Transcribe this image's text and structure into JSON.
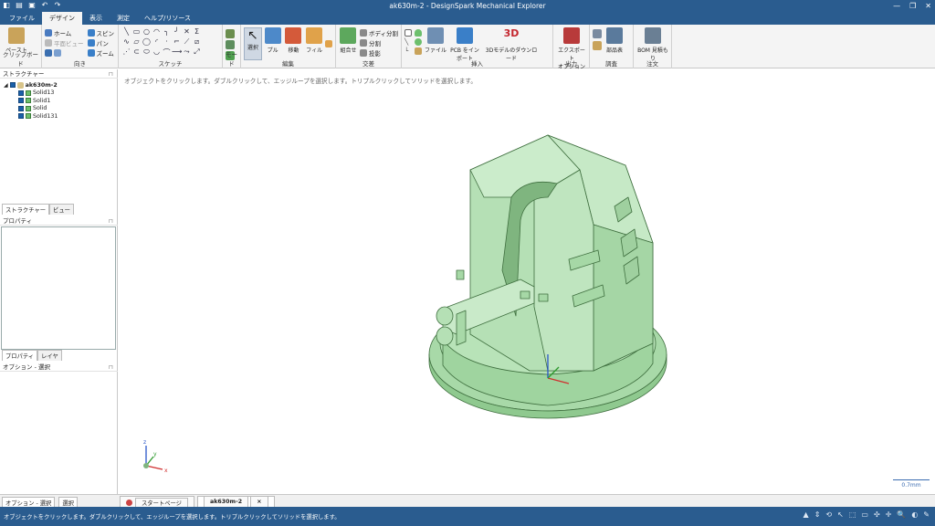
{
  "window": {
    "title": "ak630m-2 - DesignSpark Mechanical Explorer"
  },
  "menu": {
    "tabs": [
      "ファイル",
      "デザイン",
      "表示",
      "測定",
      "ヘルプ/リソース"
    ],
    "active_index": 1
  },
  "ribbon": {
    "clipboard": {
      "paste": "ペースト",
      "label": "クリップボード"
    },
    "orient": {
      "home": "ホーム",
      "spin": "スピン",
      "plan_view": "平面ビュー",
      "pan": "パン",
      "zoom": "ズーム",
      "label": "向き"
    },
    "sketch": {
      "label": "スケッチ"
    },
    "mode": {
      "label": "モード"
    },
    "edit": {
      "select": "選択",
      "pull": "プル",
      "move": "移動",
      "fill": "フィル",
      "label": "編集"
    },
    "intersect": {
      "combine": "組合せ",
      "body_split": "ボディ分割",
      "split": "分割",
      "project": "投影",
      "label": "交差"
    },
    "insert": {
      "file": "ファイル",
      "pcb": "PCB をインポート",
      "model3d": "3Dモデルのダウンロード",
      "label": "挿入"
    },
    "output": {
      "export": "エクスポート",
      "options": "オプション",
      "label": "出力"
    },
    "investigate": {
      "parts_table": "部品表",
      "label": "調査"
    },
    "order": {
      "bom": "BOM 見積もり",
      "label": "注文"
    }
  },
  "structure": {
    "header": "ストラクチャー",
    "root": "ak630m-2",
    "items": [
      "Solid13",
      "Solid1",
      "Solid",
      "Solid131"
    ],
    "tabs": [
      "ストラクチャー",
      "ビュー"
    ]
  },
  "properties": {
    "header": "プロパティ",
    "tabs": [
      "プロパティ",
      "レイヤ"
    ]
  },
  "options": {
    "header": "オプション - 選択"
  },
  "viewport": {
    "hint": "オブジェクトをクリックします。ダブルクリックして、エッジループを選択します。トリプルクリックしてソリッドを選択します。",
    "scale": "0.7mm",
    "axis_x": "x",
    "axis_y": "y",
    "axis_z": "z"
  },
  "bottom": {
    "left_tabs": [
      "オプション - 選択",
      "選択"
    ],
    "doc_tabs": [
      "スタートページ",
      "ak630m-2"
    ]
  },
  "status": {
    "message": "オブジェクトをクリックします。ダブルクリックして、エッジループを選択します。トリプルクリックしてソリッドを選択します。"
  },
  "colors": {
    "chrome": "#2a5c8f",
    "model_fill": "#a8d9a8",
    "model_edge": "#3f6f3f"
  }
}
